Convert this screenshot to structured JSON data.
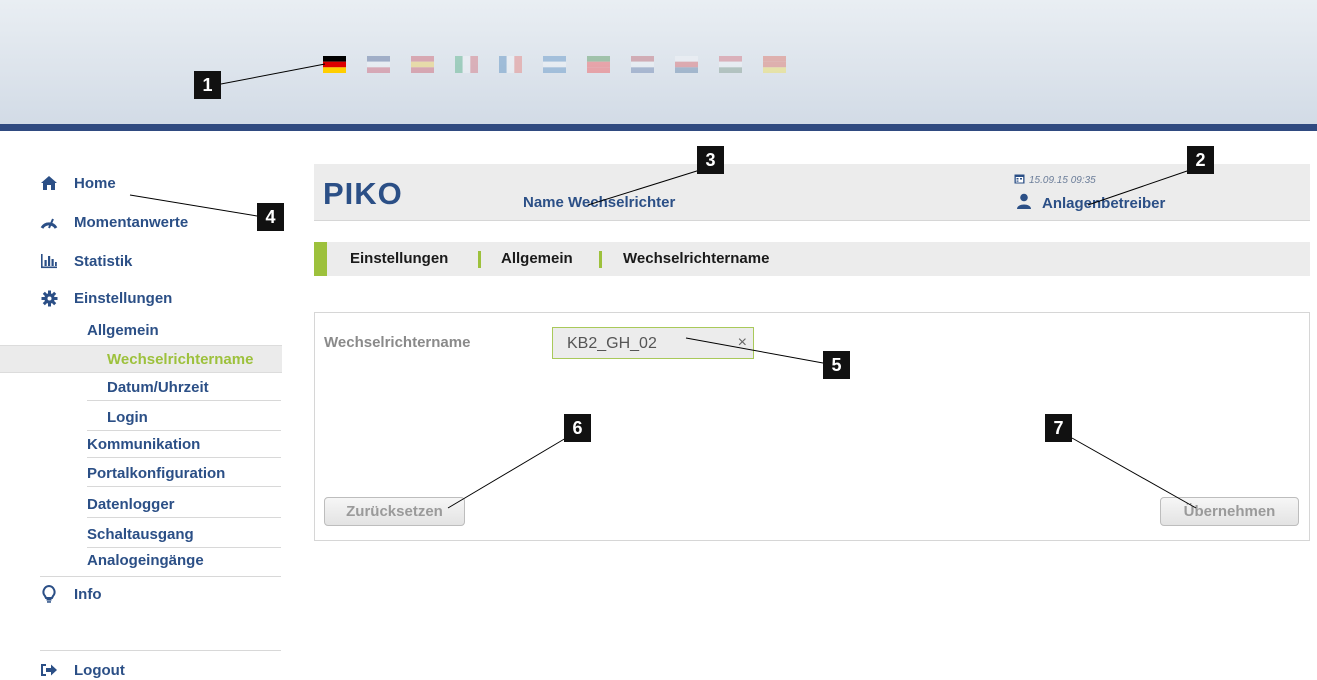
{
  "languages": [
    {
      "name": "flag-de",
      "colors": [
        "#000000",
        "#dd0000",
        "#ffce00"
      ],
      "active": true
    },
    {
      "name": "flag-gb",
      "colors": [
        "#012169",
        "#ffffff",
        "#c8102e"
      ],
      "active": false
    },
    {
      "name": "flag-es",
      "colors": [
        "#c60b1e",
        "#ffc400",
        "#c60b1e"
      ],
      "active": false
    },
    {
      "name": "flag-it",
      "colors": [
        "#009246",
        "#ffffff",
        "#ce2b37"
      ],
      "active": false
    },
    {
      "name": "flag-fr",
      "colors": [
        "#0055a4",
        "#ffffff",
        "#ef4135"
      ],
      "active": false
    },
    {
      "name": "flag-gr",
      "colors": [
        "#0d5eaf",
        "#ffffff",
        "#0d5eaf"
      ],
      "active": false
    },
    {
      "name": "flag-pt",
      "colors": [
        "#006600",
        "#ff0000",
        "#ff0000"
      ],
      "active": false
    },
    {
      "name": "flag-nl",
      "colors": [
        "#ae1c28",
        "#ffffff",
        "#21468b"
      ],
      "active": false
    },
    {
      "name": "flag-cz",
      "colors": [
        "#ffffff",
        "#d7141a",
        "#11457e"
      ],
      "active": false
    },
    {
      "name": "flag-hu",
      "colors": [
        "#ce2939",
        "#ffffff",
        "#477050"
      ],
      "active": false
    },
    {
      "name": "flag-cn",
      "colors": [
        "#de2910",
        "#de2910",
        "#ffde00"
      ],
      "active": false
    }
  ],
  "sidebar": {
    "home": "Home",
    "momentanwerte": "Momentanwerte",
    "statistik": "Statistik",
    "einstellungen": "Einstellungen",
    "allgemein": "Allgemein",
    "wechselrichtername": "Wechselrichtername",
    "datum": "Datum/Uhrzeit",
    "login": "Login",
    "kommunikation": "Kommunikation",
    "portal": "Portalkonfiguration",
    "datenlogger": "Datenlogger",
    "schaltausgang": "Schaltausgang",
    "analog": "Analogeingänge",
    "info": "Info",
    "logout": "Logout"
  },
  "header": {
    "logo": "PIKO",
    "inverter_name": "Name Wechselrichter",
    "datetime": "15.09.15 09:35",
    "user": "Anlagenbetreiber"
  },
  "breadcrumb": [
    "Einstellungen",
    "Allgemein",
    "Wechselrichtername"
  ],
  "form": {
    "label": "Wechselrichtername",
    "value": "KB2_GH_02",
    "clear": "×",
    "reset": "Zurücksetzen",
    "apply": "Übernehmen"
  },
  "callouts": [
    "1",
    "2",
    "3",
    "4",
    "5",
    "6",
    "7"
  ],
  "colors": {
    "accent": "#9dc13c",
    "brand": "#2b4f86",
    "rule": "#2f4a80"
  }
}
